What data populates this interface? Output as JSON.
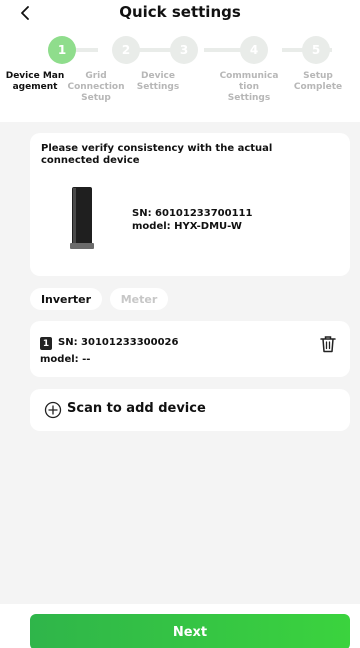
{
  "header": {
    "title": "Quick settings",
    "back_icon": "chevron-left-icon"
  },
  "stepper": {
    "active_step": 1,
    "steps": [
      {
        "number": "1",
        "label": "Device Man agement"
      },
      {
        "number": "2",
        "label": "Grid Connection Setup"
      },
      {
        "number": "3",
        "label": "Device Settings"
      },
      {
        "number": "4",
        "label": "Communica tion Settings"
      },
      {
        "number": "5",
        "label": "Setup Complete"
      }
    ]
  },
  "device_card": {
    "verify_text": "Please verify consistency with the actual connected device",
    "sn": "SN: 60101233700111",
    "model": "model: HYX-DMU-W"
  },
  "tabs": {
    "inverter": "Inverter",
    "meter": "Meter"
  },
  "inverter_list": [
    {
      "index": "1",
      "sn": "SN: 30101233300026",
      "model": "model: --"
    }
  ],
  "scan": {
    "label": "Scan to add device"
  },
  "footer": {
    "next_label": "Next"
  },
  "colors": {
    "accent_green": "#34c042",
    "step_active": "#8fdd8c",
    "step_inactive": "#e9ece9"
  }
}
